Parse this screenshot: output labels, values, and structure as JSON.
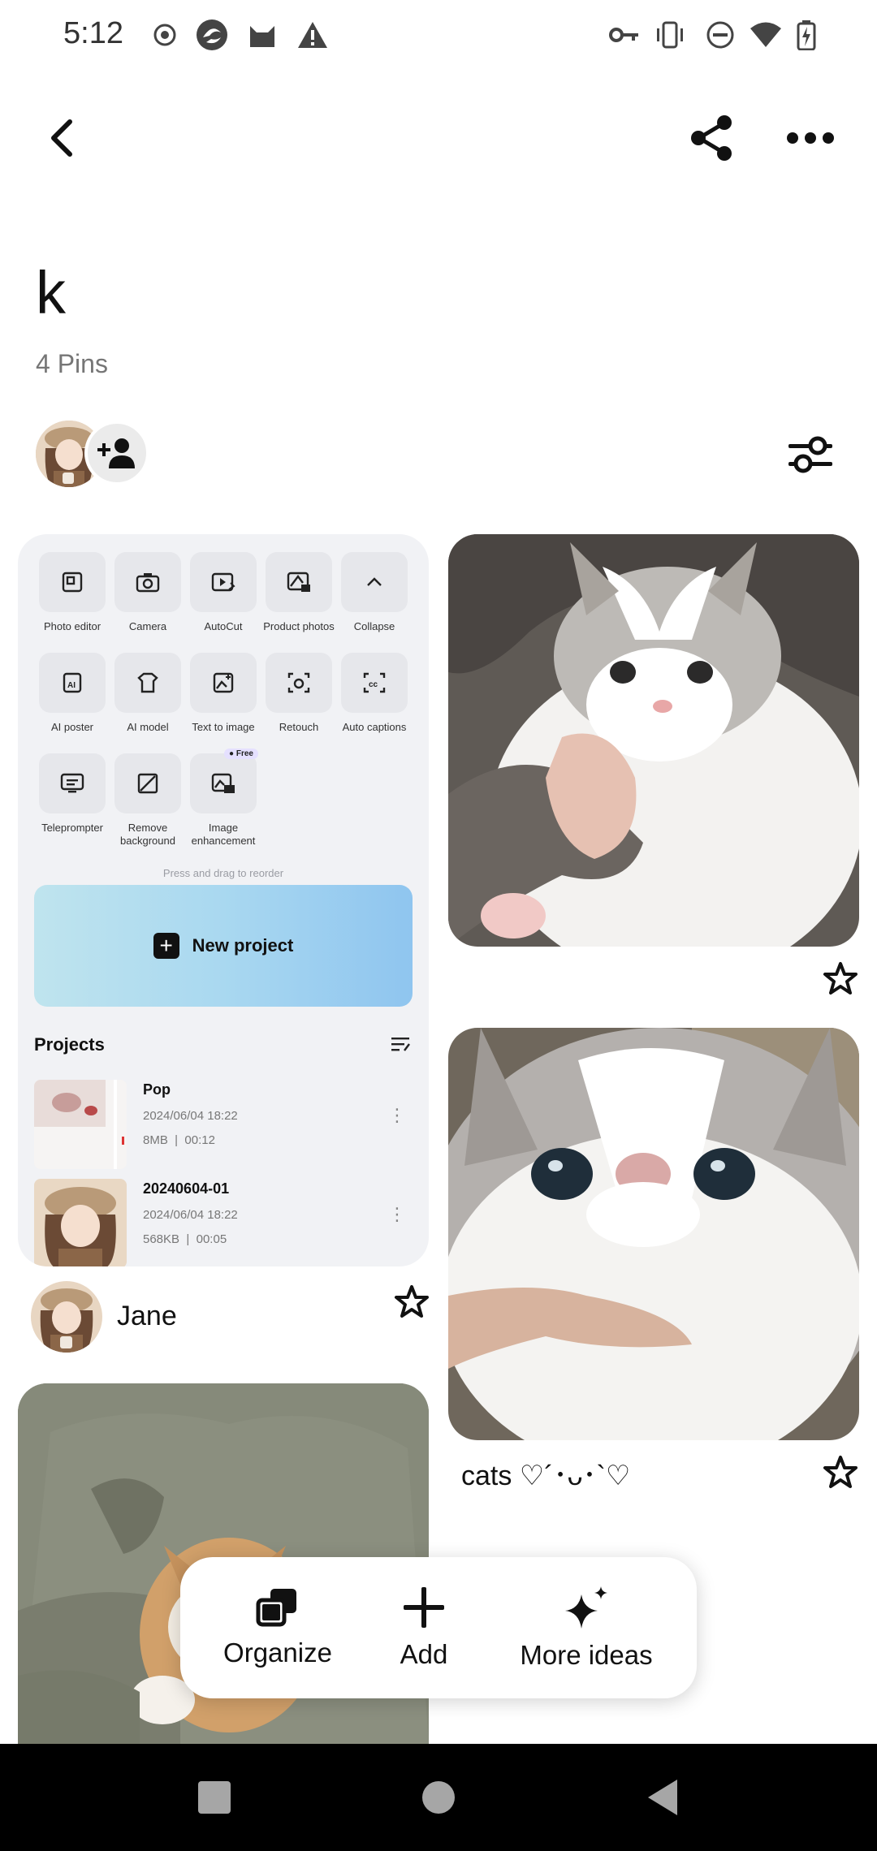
{
  "status_bar": {
    "time": "5:12",
    "left_icons": [
      "record-icon",
      "browser-icon",
      "cat-app-icon",
      "warning-icon"
    ],
    "right_icons": [
      "vpn-key-icon",
      "vibrate-icon",
      "dnd-icon",
      "wifi-icon",
      "battery-charging-icon"
    ]
  },
  "header": {
    "back_icon": "chevron-left-icon",
    "share_icon": "share-icon",
    "more_icon": "more-horizontal-icon"
  },
  "board": {
    "title": "k",
    "pin_count": "4 Pins"
  },
  "app_screenshot": {
    "tools_row1": [
      "Photo editor",
      "Camera",
      "AutoCut",
      "Product photos",
      "Collapse"
    ],
    "tools_row2": [
      "AI poster",
      "AI model",
      "Text to image",
      "Retouch",
      "Auto captions"
    ],
    "tools_row3": [
      "Teleprompter",
      "Remove background",
      "Image enhancement"
    ],
    "free_badge": "Free",
    "reorder_hint": "Press and drag to reorder",
    "new_project": "New project",
    "projects_title": "Projects",
    "projects": [
      {
        "name": "Pop",
        "date": "2024/06/04 18:22",
        "size": "8MB",
        "duration": "00:12"
      },
      {
        "name": "20240604-01",
        "date": "2024/06/04 18:22",
        "size": "568KB",
        "duration": "00:05"
      }
    ]
  },
  "pins": {
    "pin1_author": "Jane",
    "pin3_caption": "cats ♡´･ᴗ･`♡"
  },
  "action_bar": {
    "organize": "Organize",
    "add": "Add",
    "more_ideas": "More ideas"
  },
  "colors": {
    "accent_text": "#111111",
    "muted_text": "#767676",
    "nav_background": "#000000"
  }
}
